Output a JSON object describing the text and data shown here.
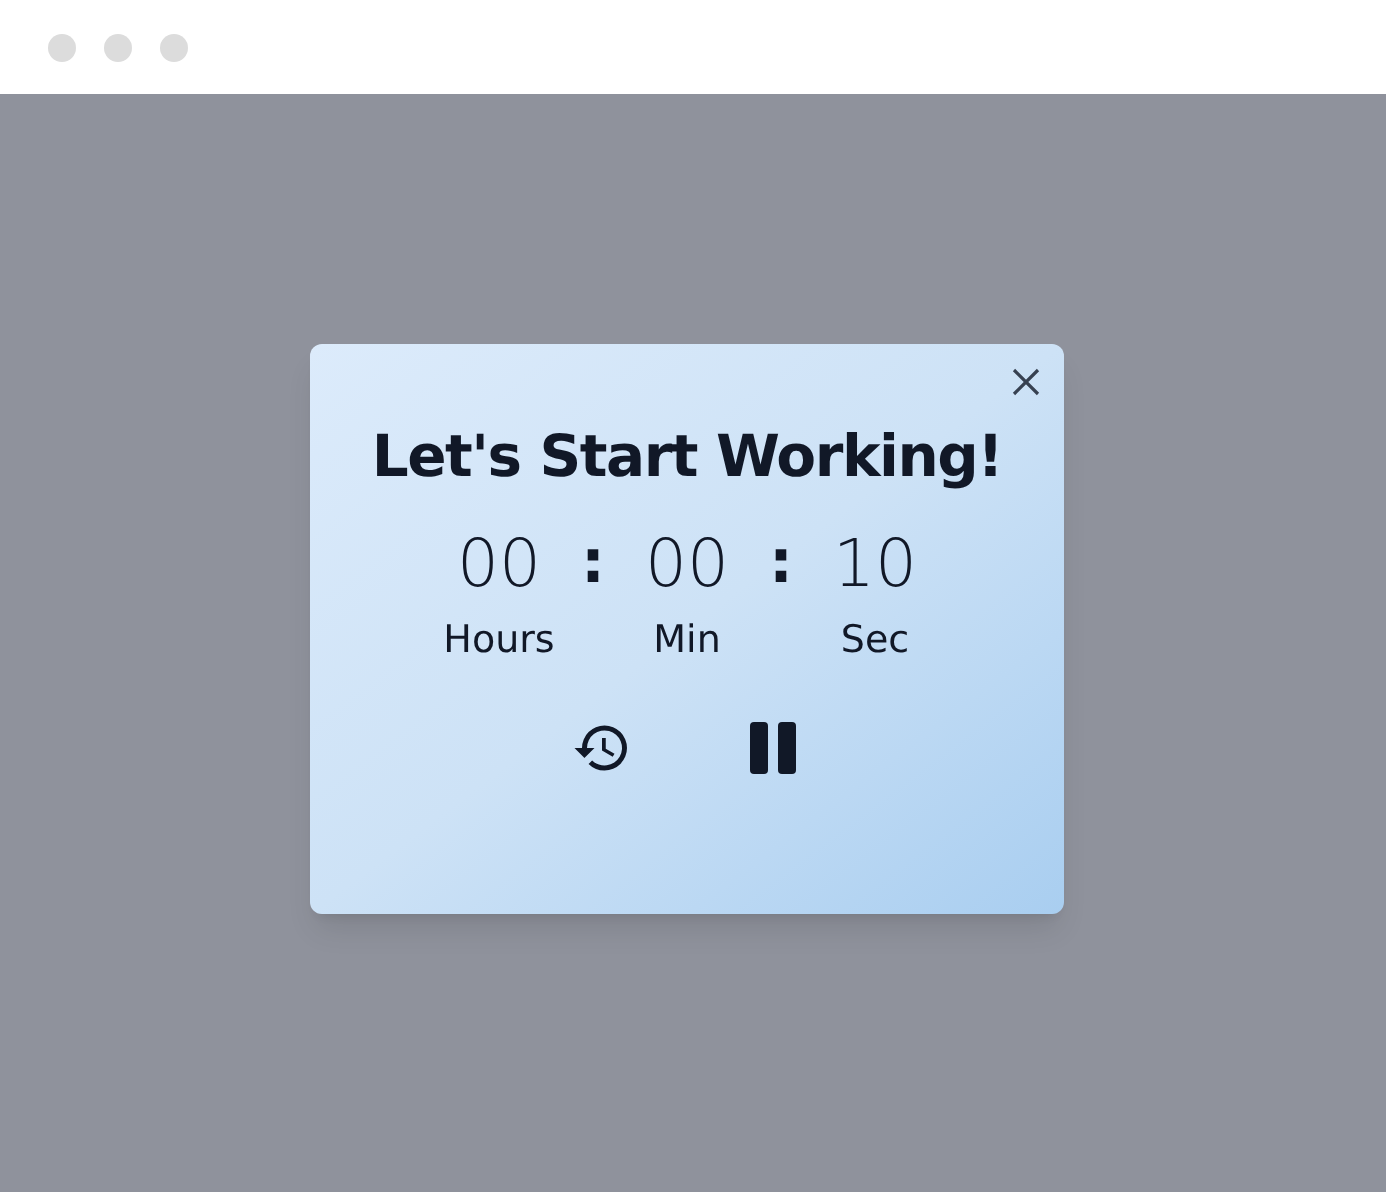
{
  "dialog": {
    "title": "Let's Start Working!",
    "units": [
      {
        "value": "00",
        "label": "Hours"
      },
      {
        "value": "00",
        "label": "Min"
      },
      {
        "value": "10",
        "label": "Sec"
      }
    ],
    "separators": [
      ":",
      ":"
    ]
  }
}
